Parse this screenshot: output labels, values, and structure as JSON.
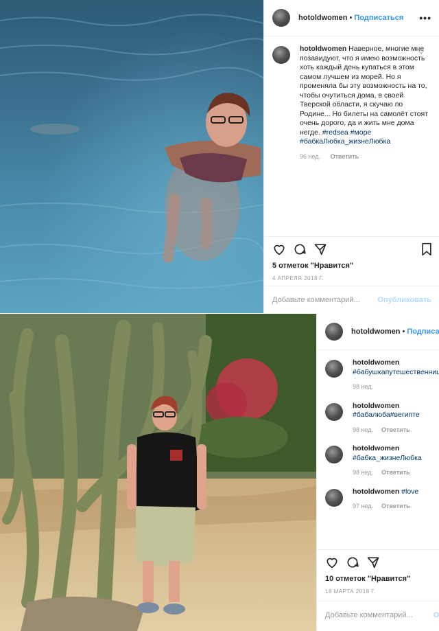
{
  "post1": {
    "username": "hotoldwomen",
    "follow_label": "Подписаться",
    "dot": "•",
    "more": "•••",
    "caption": {
      "username": "hotoldwomen",
      "text": "Наверное, многие мне позавидуют, что я имею возможность хоть каждый день купаться в этом самом лучшем из морей. Но я променяла бы эту возможность на то, чтобы очутиться дома, в своей Тверской области, я скучаю по Родине... Но билеты на самолёт стоят очень дорого, да и жить мне дома негде.",
      "tags": [
        "#redsea",
        "#море",
        "#бабкаЛюбка_жизнеЛюбка"
      ],
      "time": "96 нед.",
      "reply": "Ответить"
    },
    "likes": "5 отметок \"Нравится\"",
    "date": "4 АПРЕЛЯ 2018 Г.",
    "add_comment_placeholder": "Добавьте комментарий...",
    "publish_label": "Опубликовать"
  },
  "post2": {
    "username": "hotoldwomen",
    "follow_label": "Подписаться",
    "dot": "•",
    "comments": [
      {
        "username": "hotoldwomen",
        "tag": "#бабушкапутешественница",
        "time": "98 нед.",
        "reply": ""
      },
      {
        "username": "hotoldwomen",
        "tag": "#бабалюба#вегипте",
        "time": "98 нед.",
        "reply": "Ответить"
      },
      {
        "username": "hotoldwomen",
        "tag": "#бабка_жизнеЛюбка",
        "time": "98 нед.",
        "reply": "Ответить"
      },
      {
        "username": "hotoldwomen",
        "tag": "#love",
        "time": "97 нед.",
        "reply": "Ответить"
      }
    ],
    "likes": "10 отметок \"Нравится\"",
    "date": "18 МАРТА 2018 Г.",
    "add_comment_placeholder": "Добавьте комментарий...",
    "publish_label": "Оп"
  },
  "colors": {
    "link": "#3897f0",
    "hashtag": "#003569",
    "muted": "#999999",
    "text": "#262626"
  }
}
